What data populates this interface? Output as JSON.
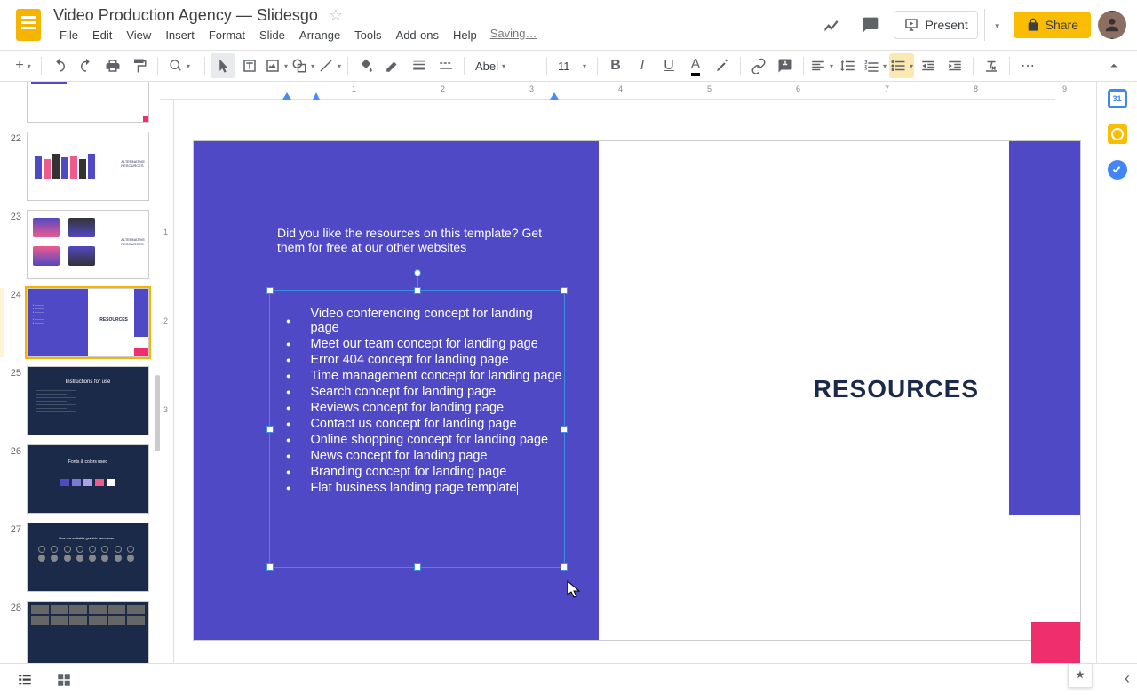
{
  "doc_title": "Video Production Agency — Slidesgo",
  "menu": {
    "file": "File",
    "edit": "Edit",
    "view": "View",
    "insert": "Insert",
    "format": "Format",
    "slide": "Slide",
    "arrange": "Arrange",
    "tools": "Tools",
    "addons": "Add-ons",
    "help": "Help"
  },
  "saving": "Saving…",
  "present": "Present",
  "share": "Share",
  "toolbar": {
    "font": "Abel",
    "size": "11"
  },
  "thumbs": [
    {
      "n": "22"
    },
    {
      "n": "23"
    },
    {
      "n": "24"
    },
    {
      "n": "25"
    },
    {
      "n": "26"
    },
    {
      "n": "27"
    },
    {
      "n": "28"
    }
  ],
  "selected_thumb": "24",
  "slide": {
    "intro": "Did you like the resources on this template? Get them for free at our other websites",
    "title": "RESOURCES",
    "bullets": [
      "Video conferencing concept for landing page",
      "Meet our team concept for landing page",
      "Error 404 concept for landing page",
      "Time management concept for landing page",
      "Search concept for landing page",
      "Reviews concept for landing page",
      "Contact us concept for landing page",
      "Online shopping concept for landing page",
      "News concept for landing page",
      "Branding concept for landing page",
      " Flat business landing page template"
    ]
  },
  "ruler_marks": [
    "1",
    "2",
    "3",
    "4",
    "5",
    "6",
    "7",
    "8",
    "9"
  ],
  "ruler_v": [
    "1",
    "2",
    "3"
  ],
  "colors": {
    "purple": "#5049c5",
    "pink": "#ef2e6e",
    "dark": "#1c2a4a",
    "gold": "#f4b400"
  }
}
